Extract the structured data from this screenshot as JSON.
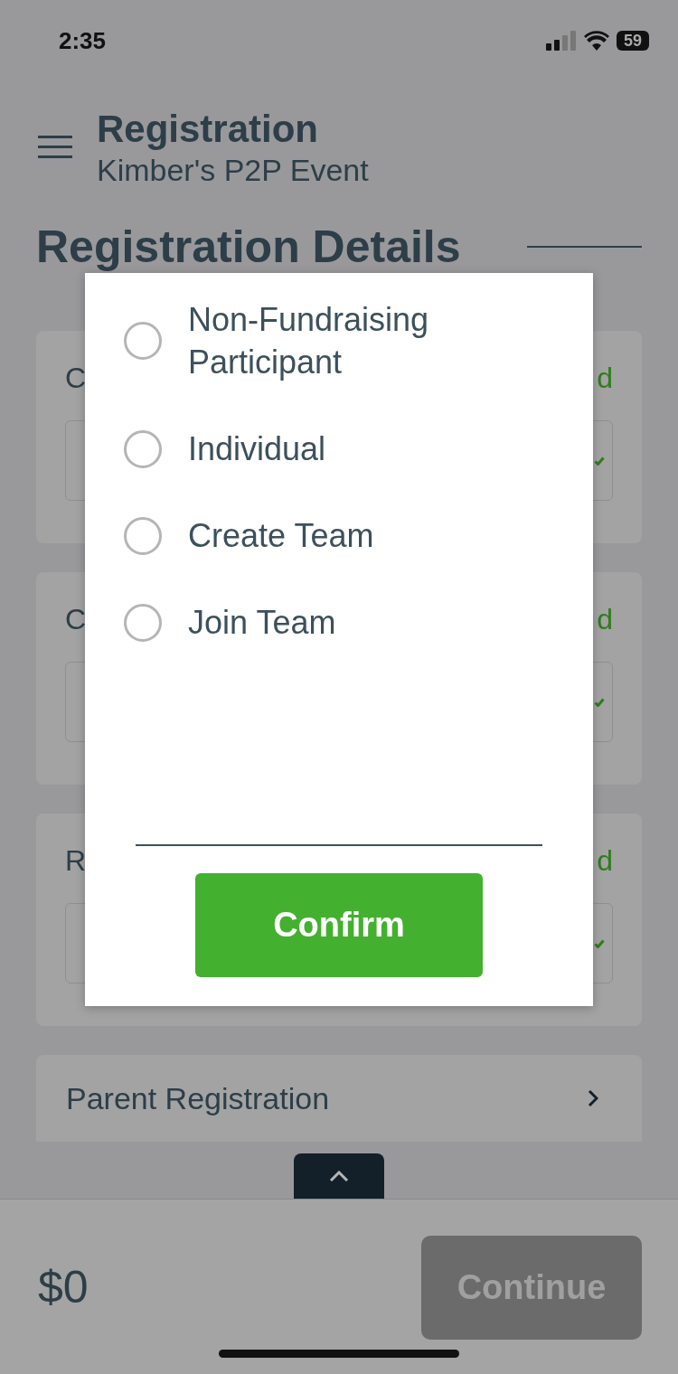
{
  "status_bar": {
    "time": "2:35",
    "battery": "59"
  },
  "header": {
    "title": "Registration",
    "subtitle": "Kimber's P2P Event"
  },
  "section": {
    "heading": "Registration Details"
  },
  "cards": [
    {
      "label": "C",
      "status": "d"
    },
    {
      "label": "C",
      "status": "d"
    },
    {
      "label": "R",
      "status": "d"
    }
  ],
  "link_row": {
    "label": "Parent Registration"
  },
  "modal": {
    "options": [
      {
        "label": "Non-Fundraising Participant",
        "selected": false
      },
      {
        "label": "Individual",
        "selected": false
      },
      {
        "label": "Create Team",
        "selected": false
      },
      {
        "label": "Join Team",
        "selected": false
      }
    ],
    "confirm": "Confirm"
  },
  "footer": {
    "total": "$0",
    "continue": {
      "label": "Continue",
      "disabled": true
    }
  }
}
